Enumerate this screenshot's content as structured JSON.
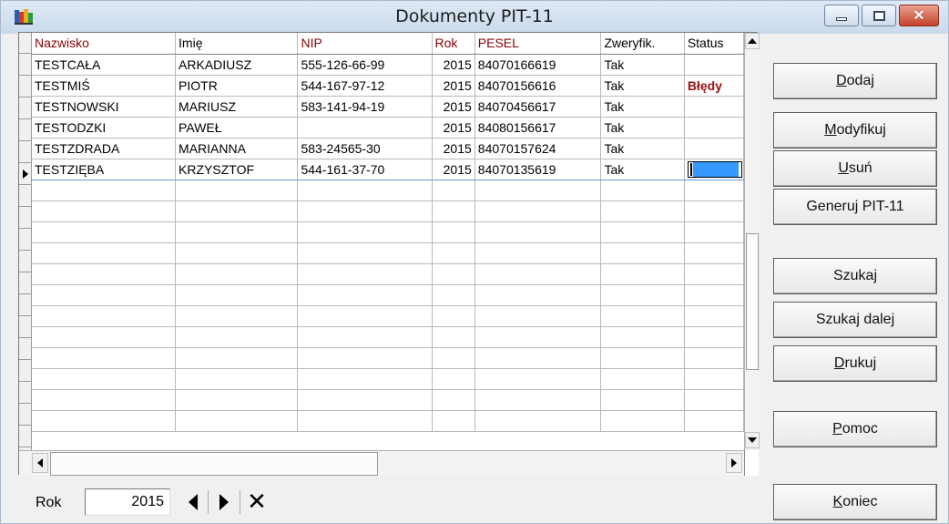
{
  "window": {
    "title": "Dokumenty PIT-11"
  },
  "grid": {
    "columns": [
      "Nazwisko",
      "Imię",
      "NIP",
      "Rok",
      "PESEL",
      "Zweryfik.",
      "Status"
    ],
    "rows": [
      [
        "TESTCAŁA",
        "ARKADIUSZ",
        "555-126-66-99",
        "2015",
        "84070166619",
        "Tak",
        ""
      ],
      [
        "TESTMIŚ",
        "PIOTR",
        "544-167-97-12",
        "2015",
        "84070156616",
        "Tak",
        "Błędy"
      ],
      [
        "TESTNOWSKI",
        "MARIUSZ",
        "583-141-94-19",
        "2015",
        "84070456617",
        "Tak",
        ""
      ],
      [
        "TESTODZKI",
        "PAWEŁ",
        "",
        "2015",
        "84080156617",
        "Tak",
        ""
      ],
      [
        "TESTZDRADA",
        "MARIANNA",
        "583-24565-30",
        "2015",
        "84070157624",
        "Tak",
        ""
      ],
      [
        "TESTZIĘBA",
        "KRZYSZTOF",
        "544-161-37-70",
        "2015",
        "84070135619",
        "Tak",
        ""
      ]
    ],
    "current_row": 6
  },
  "buttons": {
    "dodaj": {
      "u": "D",
      "rest": "odaj"
    },
    "modyfikuj": {
      "u": "M",
      "rest": "odyfikuj"
    },
    "usun": {
      "u": "U",
      "rest": "suń"
    },
    "generuj": "Generuj PIT-11",
    "szukaj": "Szukaj",
    "szukaj_dalej": "Szukaj dalej",
    "drukuj": {
      "u": "D",
      "rest": "rukuj"
    },
    "pomoc": {
      "u": "P",
      "rest": "omoc"
    },
    "koniec": {
      "u": "K",
      "rest": "oniec"
    }
  },
  "bottom": {
    "rok_label": "Rok",
    "rok_value": "2015"
  },
  "colors": {
    "header_text": "#8b0000",
    "error_text": "#9a1010",
    "selection": "#3399ff"
  }
}
